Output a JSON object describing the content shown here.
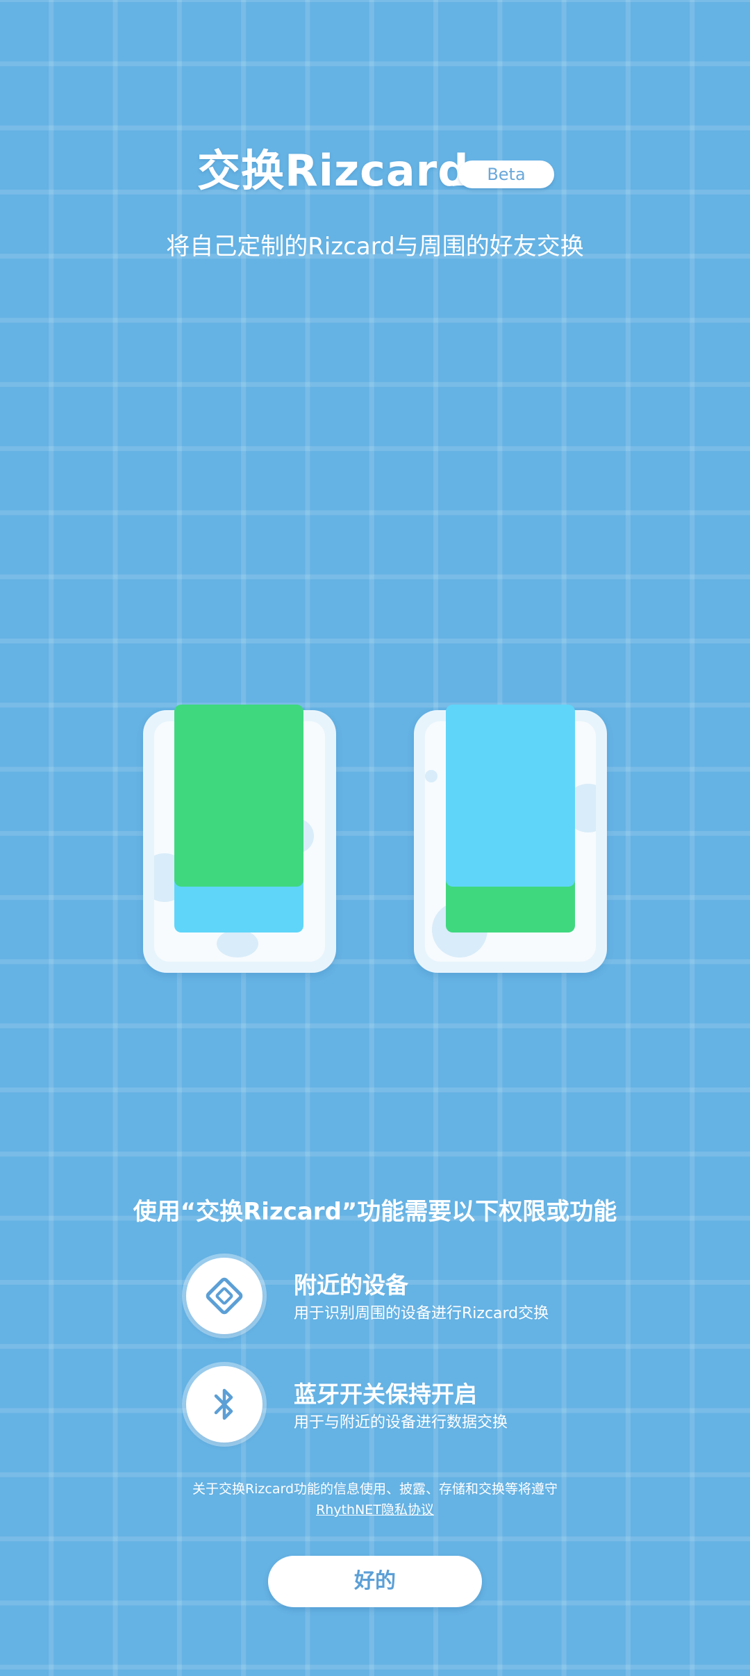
{
  "header": {
    "title": "交换Rizcard",
    "badge": "Beta",
    "subtitle": "将自己定制的Rizcard与周围的好友交换"
  },
  "illustration": {
    "colors": {
      "green_card": "#3fd87f",
      "blue_card": "#5fd5f9",
      "phone_frame": "#e8f4fc"
    }
  },
  "permissions": {
    "heading": "使用“交换Rizcard”功能需要以下权限或功能",
    "items": [
      {
        "icon": "nearby-devices-icon",
        "title": "附近的设备",
        "description": "用于识别周围的设备进行Rizcard交换"
      },
      {
        "icon": "bluetooth-icon",
        "title": "蓝牙开关保持开启",
        "description": "用于与附近的设备进行数据交换"
      }
    ]
  },
  "privacy": {
    "notice": "关于交换Rizcard功能的信息使用、披露、存储和交换等将遵守",
    "link_label": "RhythNET隐私协议"
  },
  "actions": {
    "ok_label": "好的"
  },
  "theme": {
    "background": "#65b2e4",
    "accent": "#5b9fd6"
  }
}
